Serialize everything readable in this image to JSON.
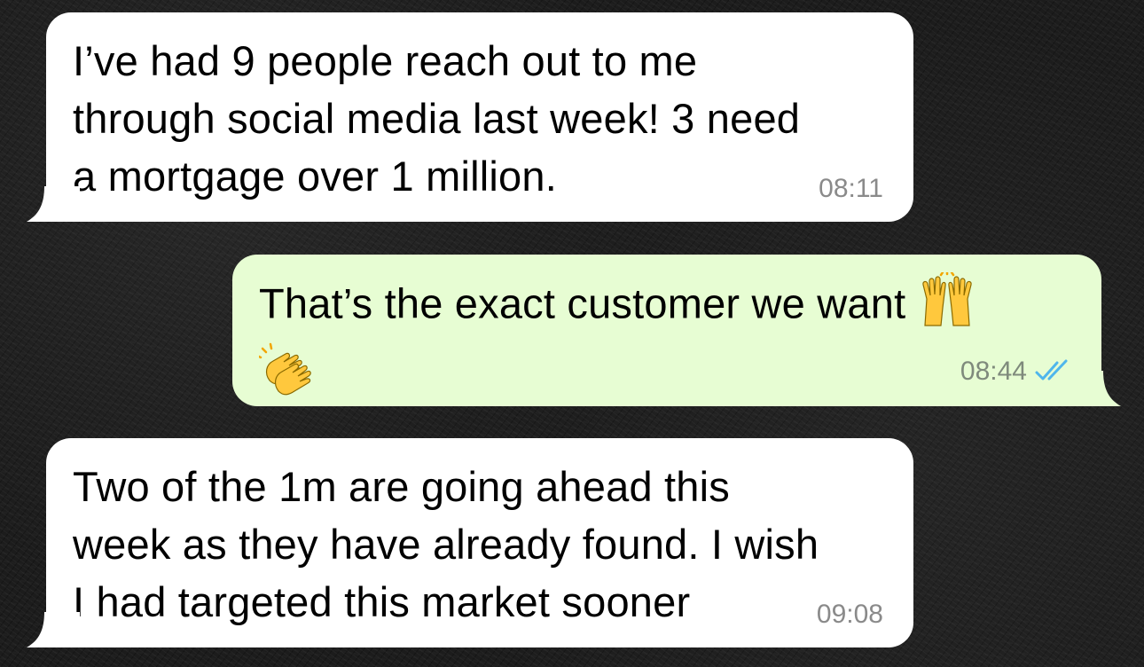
{
  "messages": [
    {
      "direction": "incoming",
      "text": "I’ve had 9 people reach out to me\nthrough social media last week! 3 need\na mortgage over 1 million.",
      "time": "08:11"
    },
    {
      "direction": "outgoing",
      "text": "That’s the exact customer we want",
      "emojis": [
        "raising-hands-emoji",
        "clapping-hands-emoji"
      ],
      "time": "08:44",
      "status_icon": "double-check-read-icon"
    },
    {
      "direction": "incoming",
      "text": "Two of the 1m are going ahead this\nweek as they have already found. I wish\nI had targeted this market sooner",
      "time": "09:08"
    }
  ],
  "colors": {
    "incoming_bubble": "#ffffff",
    "outgoing_bubble": "#e7fdd3",
    "read_check": "#4fb6ec",
    "timestamp": "#8a8a8a"
  }
}
